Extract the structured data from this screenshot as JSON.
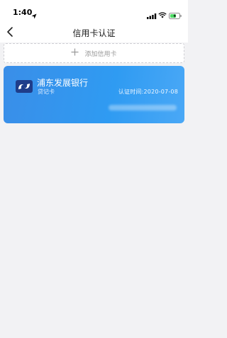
{
  "status_bar": {
    "time": "1:40",
    "icons": [
      "location-arrow-icon",
      "signal-icon",
      "wifi-icon",
      "battery-charging-icon"
    ]
  },
  "nav": {
    "title": "信用卡认证",
    "back_icon": "chevron-left-icon"
  },
  "add_card": {
    "icon": "plus-icon",
    "label": "添加信用卡"
  },
  "cards": [
    {
      "bank_name": "浦东发展银行",
      "card_type": "贷记卡",
      "verify_time": "认证时间:2020-07-08",
      "logo_color": "#1f3d8a"
    }
  ],
  "colors": {
    "card_gradient_start": "#3a8ee8",
    "card_gradient_end": "#4aa8f6",
    "page_bg": "#f2f2f4",
    "accent_battery": "#4cd964"
  }
}
